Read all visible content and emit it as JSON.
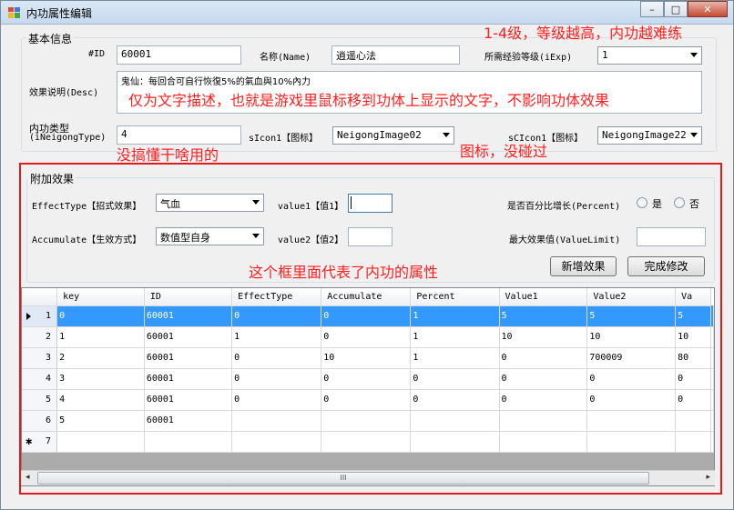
{
  "window": {
    "title": "内功属性编辑",
    "min": "–",
    "max": "□",
    "close": "✕"
  },
  "basic": {
    "group_title": "基本信息",
    "id_label": "#ID",
    "id_value": "60001",
    "name_label": "名称(Name)",
    "name_value": "逍遥心法",
    "exp_label": "所需经验等级(iExp)",
    "exp_value": "1",
    "desc_label": "效果说明(Desc)",
    "desc_value": "鬼仙：每回合可自行恢復5%的氣血與10%內力",
    "type_label_1": "内功类型",
    "type_label_2": "(iNeigongType)",
    "type_value": "4",
    "sicon_label": "sIcon1【图标】",
    "sicon_value": "NeigongImage02",
    "scicon_label": "sCIcon1【图标】",
    "scicon_value": "NeigongImage22"
  },
  "effect": {
    "group_title": "附加效果",
    "effect_type_label": "EffectType【招式效果】",
    "effect_type_value": "气血",
    "value1_label": "value1【值1】",
    "value1_value": "",
    "percent_label": "是否百分比增长(Percent)",
    "radio_yes": "是",
    "radio_no": "否",
    "accumulate_label": "Accumulate【生效方式】",
    "accumulate_value": "数值型自身",
    "value2_label": "value2【值2】",
    "value2_value": "",
    "limit_label": "最大效果值(ValueLimit)",
    "limit_value": "",
    "add_button": "新增效果",
    "done_button": "完成修改"
  },
  "grid": {
    "columns": [
      "key",
      "ID",
      "EffectType",
      "Accumulate",
      "Percent",
      "Value1",
      "Value2",
      "Va"
    ],
    "rows": [
      {
        "num": "1",
        "cells": [
          "0",
          "60001",
          "0",
          "0",
          "1",
          "5",
          "5",
          "5"
        ]
      },
      {
        "num": "2",
        "cells": [
          "1",
          "60001",
          "1",
          "0",
          "1",
          "10",
          "10",
          "10"
        ]
      },
      {
        "num": "3",
        "cells": [
          "2",
          "60001",
          "0",
          "10",
          "1",
          "0",
          "700009",
          "80"
        ]
      },
      {
        "num": "4",
        "cells": [
          "3",
          "60001",
          "0",
          "0",
          "0",
          "0",
          "0",
          "0"
        ]
      },
      {
        "num": "5",
        "cells": [
          "4",
          "60001",
          "0",
          "0",
          "0",
          "0",
          "0",
          "0"
        ]
      },
      {
        "num": "6",
        "cells": [
          "5",
          "60001",
          "",
          "",
          "",
          "",
          "",
          ""
        ]
      },
      {
        "num": "7",
        "cells": [
          "",
          "",
          "",
          "",
          "",
          "",
          "",
          ""
        ]
      }
    ],
    "scroll_grip": "III"
  },
  "annotations": {
    "level": "1-4级，等级越高，内功越难练",
    "desc": "仅为文字描述，也就是游戏里鼠标移到功体上显示的文字，不影响功体效果",
    "type": "没搞懂干啥用的",
    "icon": "图标，没碰过",
    "box": "这个框里面代表了内功的属性"
  }
}
